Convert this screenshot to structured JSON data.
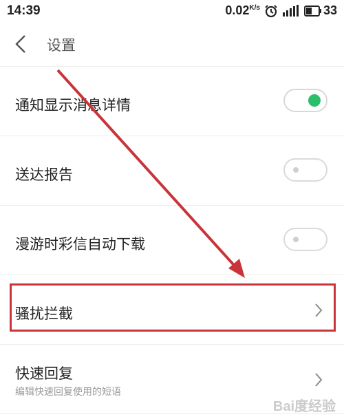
{
  "status_bar": {
    "time": "14:39",
    "speed": "0.02",
    "speed_unit": "K/s",
    "battery": "33"
  },
  "header": {
    "title": "设置"
  },
  "settings": [
    {
      "label": "通知显示消息详情",
      "control": "toggle",
      "on": true
    },
    {
      "label": "送达报告",
      "control": "toggle",
      "on": false
    },
    {
      "label": "漫游时彩信自动下载",
      "control": "toggle",
      "on": false
    },
    {
      "label": "骚扰拦截",
      "control": "chevron"
    },
    {
      "label": "快速回复",
      "sublabel": "编辑快速回复使用的短语",
      "control": "chevron"
    }
  ],
  "watermark": "Bai度经验",
  "colors": {
    "toggle_on": "#2bbf6a",
    "annotation": "#c9343a"
  }
}
